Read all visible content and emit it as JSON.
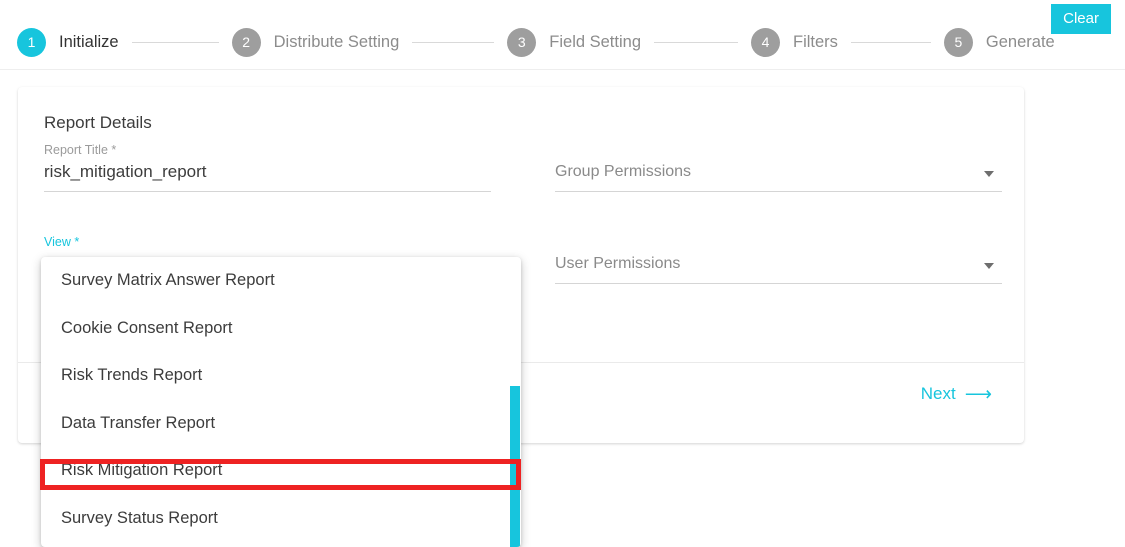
{
  "stepper": {
    "steps": [
      {
        "number": "1",
        "label": "Initialize",
        "active": true
      },
      {
        "number": "2",
        "label": "Distribute Setting",
        "active": false
      },
      {
        "number": "3",
        "label": "Field Setting",
        "active": false
      },
      {
        "number": "4",
        "label": "Filters",
        "active": false
      },
      {
        "number": "5",
        "label": "Generate",
        "active": false
      }
    ],
    "active_color": "#17c5dd",
    "inactive_color": "#9e9e9e"
  },
  "toolbar": {
    "clear_label": "Clear",
    "clear_bg": "#17c5dd"
  },
  "card": {
    "title": "Report Details",
    "fields": {
      "report_title": {
        "label": "Report Title *",
        "value": "risk_mitigation_report"
      },
      "group_permissions": {
        "placeholder": "Group Permissions"
      },
      "view": {
        "label": "View *",
        "value": ""
      },
      "user_permissions": {
        "placeholder": "User Permissions"
      }
    },
    "footer": {
      "next_label": "Next",
      "next_arrow": "⟶",
      "next_color": "#17c5dd"
    }
  },
  "dropdown": {
    "open": true,
    "items": [
      {
        "label": "Survey Matrix Answer Report",
        "highlighted": false
      },
      {
        "label": "Cookie Consent Report",
        "highlighted": false
      },
      {
        "label": "Risk Trends Report",
        "highlighted": false
      },
      {
        "label": "Data Transfer Report",
        "highlighted": false
      },
      {
        "label": "Risk Mitigation Report",
        "highlighted": true
      },
      {
        "label": "Survey Status Report",
        "highlighted": false
      }
    ],
    "scrollbar_color": "#17c5dd"
  },
  "annotation": {
    "highlight_color": "#ee2222",
    "target_label": "Risk Mitigation Report"
  }
}
